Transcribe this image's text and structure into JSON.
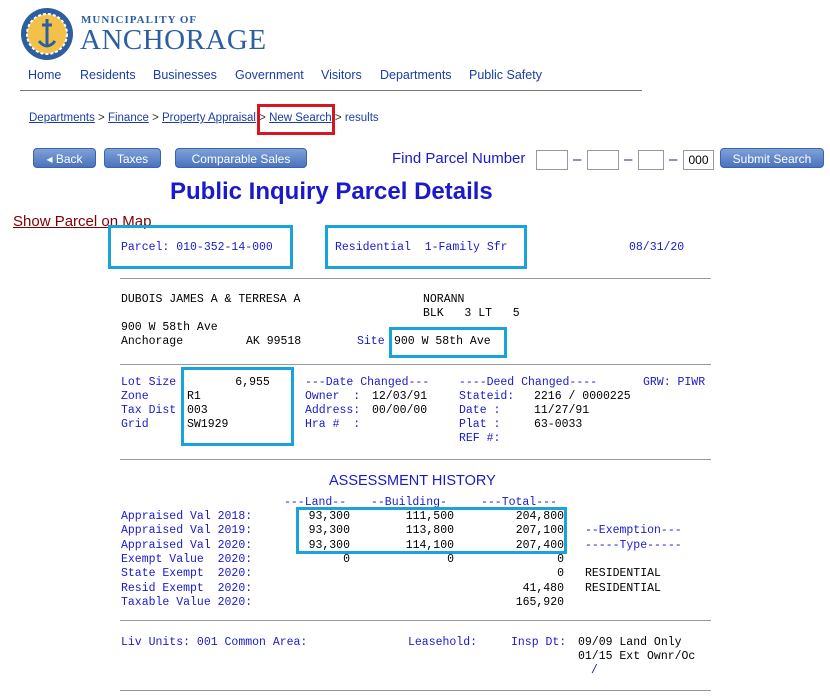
{
  "logo": {
    "top": "MUNICIPALITY OF",
    "main": "ANCHORAGE"
  },
  "nav": [
    "Home",
    "Residents",
    "Businesses",
    "Government",
    "Visitors",
    "Departments",
    "Public Safety"
  ],
  "breadcrumb": {
    "departments": "Departments",
    "finance": "Finance",
    "property": "Property Appraisal",
    "new_search": "New Search",
    "results": "results",
    "sep": " > "
  },
  "buttons": {
    "back": "◂ Back",
    "taxes": "Taxes",
    "comparable": "Comparable Sales",
    "submit": "Submit Search"
  },
  "find": {
    "label": "Find Parcel Number",
    "f1": "",
    "f2": "",
    "f3": "",
    "f4": "000"
  },
  "page_title": "Public Inquiry Parcel Details",
  "show_map": "Show Parcel on Map",
  "header": {
    "parcel": "Parcel: 010-352-14-000",
    "use": "Residential  1-Family Sfr",
    "date": "08/31/20"
  },
  "owner": {
    "name": "DUBOIS JAMES A & TERRESA A",
    "sub1": "NORANN",
    "sub2": "BLK   3 LT   5",
    "addr1": "900 W 58th Ave",
    "city": "Anchorage",
    "state_zip": "AK 99518",
    "site_label": "Site",
    "site": "900 W 58th Ave"
  },
  "details": {
    "col1_labels": "Lot Size\nZone\nTax Dist\nGrid",
    "col1_values": "       6,955\nR1\n003\nSW1929",
    "col2_labels": "---Date Changed---\nOwner  :\nAddress:\nHra #  :",
    "col2_values": "\n12/03/91\n00/00/00\n",
    "col3_labels": "----Deed Changed----\nStateid:\nDate :\nPlat :\nREF #:",
    "col3_values": "\n2216 / 0000225\n11/27/91\n63-0033\n",
    "grw": "GRW: PIWR"
  },
  "assessment": {
    "title": "ASSESSMENT HISTORY",
    "headers": {
      "land": "---Land--",
      "building": "--Building-",
      "total": "---Total---"
    },
    "rows": [
      {
        "label": "Appraised Val 2018:",
        "land": "93,300",
        "building": "111,500",
        "total": "204,800",
        "extra": ""
      },
      {
        "label": "Appraised Val 2019:",
        "land": "93,300",
        "building": "113,800",
        "total": "207,100",
        "extra": "--Exemption---"
      },
      {
        "label": "Appraised Val 2020:",
        "land": "93,300",
        "building": "114,100",
        "total": "207,400",
        "extra": "-----Type-----"
      },
      {
        "label": "Exempt Value  2020:",
        "land": "0",
        "building": "0",
        "total": "0",
        "extra": ""
      },
      {
        "label": "State Exempt  2020:",
        "land": "",
        "building": "",
        "total": "0",
        "extra": "RESIDENTIAL"
      },
      {
        "label": "Resid Exempt  2020:",
        "land": "",
        "building": "",
        "total": "41,480",
        "extra": "RESIDENTIAL"
      },
      {
        "label": "Taxable Value 2020:",
        "land": "",
        "building": "",
        "total": "165,920",
        "extra": ""
      }
    ]
  },
  "footer": {
    "liv": "Liv Units: 001 Common Area:",
    "lease": "Leasehold:",
    "insp_label": "Insp Dt:",
    "insp1": "09/09 Land Only",
    "insp2": "01/15 Ext Ownr/Oc",
    "insp3": "/"
  }
}
